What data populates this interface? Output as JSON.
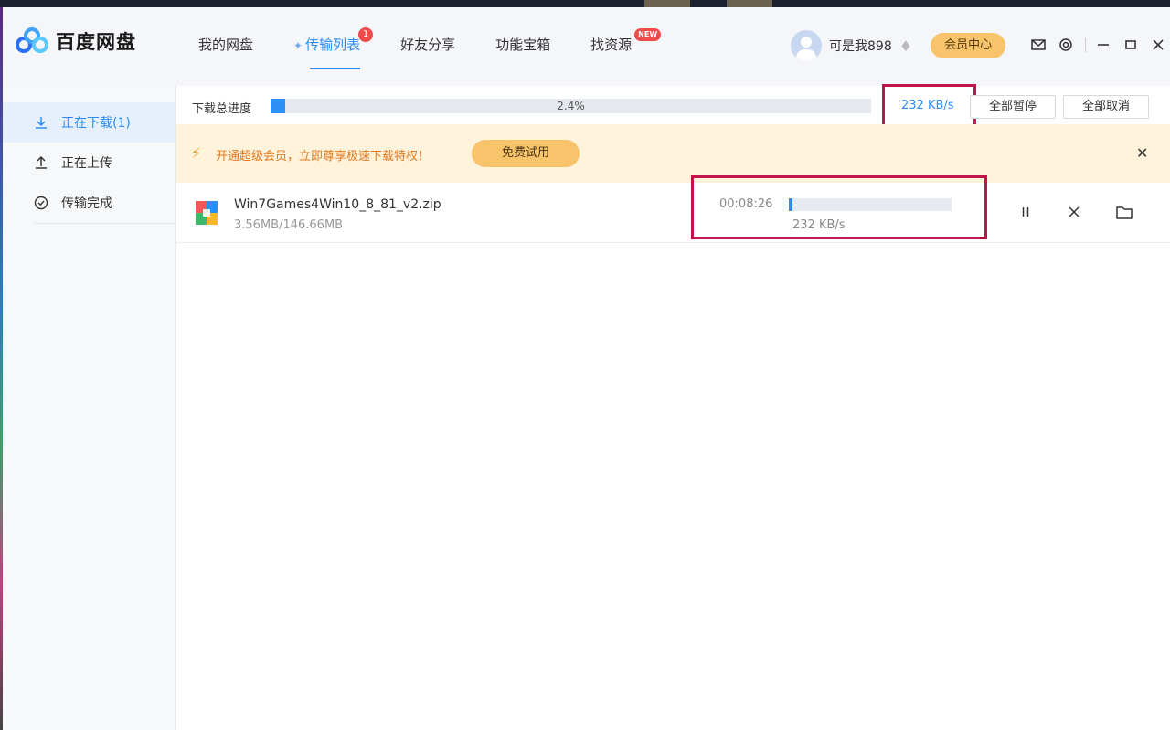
{
  "app": {
    "title": "百度网盘"
  },
  "nav": {
    "items": [
      {
        "label": "我的网盘"
      },
      {
        "label": "传输列表",
        "badge": "1"
      },
      {
        "label": "好友分享"
      },
      {
        "label": "功能宝箱"
      },
      {
        "label": "找资源",
        "badge": "NEW"
      }
    ]
  },
  "user": {
    "name": "可是我898",
    "vip_label": "会员中心"
  },
  "sidebar": {
    "items": [
      {
        "label": "正在下载(1)"
      },
      {
        "label": "正在上传"
      },
      {
        "label": "传输完成"
      }
    ]
  },
  "progress": {
    "label": "下载总进度",
    "percent_text": "2.4%",
    "percent": 2.4,
    "speed": "232 KB/s",
    "pause_all": "全部暂停",
    "cancel_all": "全部取消"
  },
  "promo": {
    "text": "开通超级会员，立即尊享极速下载特权！",
    "button": "免费试用"
  },
  "tasks": [
    {
      "name": "Win7Games4Win10_8_81_v2.zip",
      "size": "3.56MB/146.66MB",
      "time_left": "00:08:26",
      "speed": "232 KB/s",
      "percent": 2.4
    }
  ],
  "colors": {
    "accent": "#2b8ef5",
    "highlight": "#c0144a",
    "promo_bg": "#fff3dc",
    "vip": "#f7c46b"
  }
}
